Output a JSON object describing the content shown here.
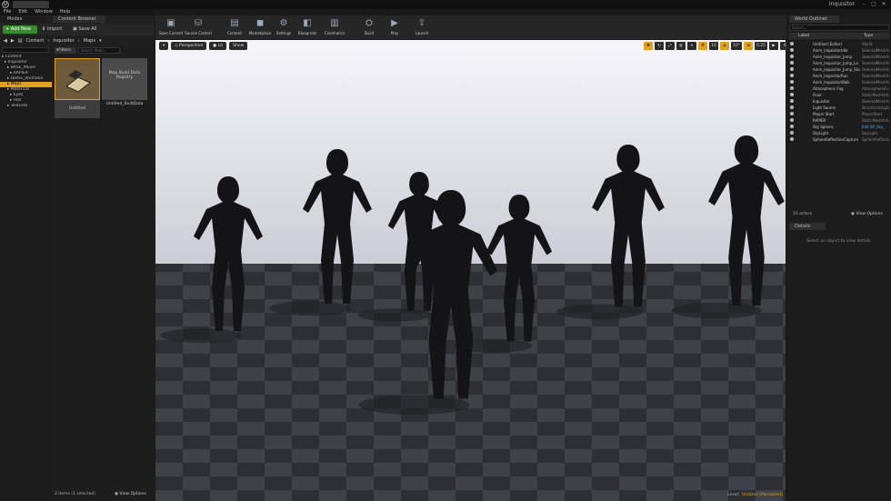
{
  "app": {
    "logo": "U",
    "project": "Inquisitor",
    "window_controls": [
      "–",
      "▢",
      "✕"
    ]
  },
  "menu": [
    "File",
    "Edit",
    "Window",
    "Help"
  ],
  "left_panel": {
    "tabs": {
      "modes": "Modes",
      "content_browser": "Content Browser"
    },
    "toolbar": {
      "add_new": "Add New",
      "import": "Import",
      "save_all": "Save All"
    },
    "breadcrumb": [
      "Content",
      "Inquisitor",
      "Maps"
    ],
    "tree": [
      {
        "label": "Content",
        "indent": 0
      },
      {
        "label": "Inquisitor",
        "indent": 1
      },
      {
        "label": "BASE_MESH",
        "indent": 2
      },
      {
        "label": "RAPIER",
        "indent": 3
      },
      {
        "label": "Demo_Animatio",
        "indent": 2
      },
      {
        "label": "Maps",
        "indent": 2,
        "selected": true
      },
      {
        "label": "Materials",
        "indent": 2
      },
      {
        "label": "Eyes",
        "indent": 3
      },
      {
        "label": "Hair",
        "indent": 3
      },
      {
        "label": "Textures",
        "indent": 2
      }
    ],
    "filters": "Filters",
    "search_placeholder": "Search Maps",
    "assets": [
      {
        "label": "Untitled",
        "thumb": "map-icon"
      },
      {
        "label": "Untitled_BuiltData",
        "thumb_text": "Map Build Data Registry"
      }
    ],
    "status": "2 items (1 selected)",
    "view_options": "View Options"
  },
  "toolbar": [
    {
      "label": "Save Current",
      "icon": "save-icon"
    },
    {
      "label": "Source Control",
      "icon": "source-control-icon"
    },
    {
      "label": "Content",
      "icon": "content-icon"
    },
    {
      "label": "Marketplace",
      "icon": "marketplace-icon"
    },
    {
      "label": "Settings",
      "icon": "settings-icon"
    },
    {
      "label": "Blueprints",
      "icon": "blueprints-icon"
    },
    {
      "label": "Cinematics",
      "icon": "cinematics-icon"
    },
    {
      "label": "Build",
      "icon": "build-icon"
    },
    {
      "label": "Play",
      "icon": "play-icon"
    },
    {
      "label": "Launch",
      "icon": "launch-icon"
    }
  ],
  "viewport": {
    "perspective": "Perspective",
    "lit": "Lit",
    "show": "Show",
    "snap": {
      "grid": "10",
      "rotation": "10°",
      "scale": "0.25",
      "camera_speed": "4"
    },
    "level_label": "Level:",
    "level_value": "Untitled (Persistent)"
  },
  "outliner": {
    "tab": "World Outliner",
    "search_placeholder": "Search...",
    "col_label": "Label",
    "col_type": "Type",
    "rows": [
      {
        "name": "Untitled (Editor)",
        "type": "World"
      },
      {
        "name": "Anim_InquisitorIdle",
        "type": "SkeletalMeshActor"
      },
      {
        "name": "Anim_Inquisitor_Jump",
        "type": "SkeletalMeshActor"
      },
      {
        "name": "Anim_Inquisitor_Jump_Lo",
        "type": "SkeletalMeshActor"
      },
      {
        "name": "Anim_Inquisitor_Jump_Sta",
        "type": "SkeletalMeshActor"
      },
      {
        "name": "Anim_InquisitorRun",
        "type": "SkeletalMeshActor"
      },
      {
        "name": "Anim_InquisitorWalk",
        "type": "SkeletalMeshActor"
      },
      {
        "name": "Atmospheric Fog",
        "type": "AtmosphericFog"
      },
      {
        "name": "Floor",
        "type": "StaticMeshActor"
      },
      {
        "name": "Inquisitor",
        "type": "SkeletalMeshActor"
      },
      {
        "name": "Light Source",
        "type": "DirectionalLight"
      },
      {
        "name": "Player Start",
        "type": "PlayerStart"
      },
      {
        "name": "RAPIER",
        "type": "StaticMeshActor"
      },
      {
        "name": "Sky Sphere",
        "type": "Edit BP_Sky_",
        "link": true
      },
      {
        "name": "SkyLight",
        "type": "SkyLight"
      },
      {
        "name": "SphereReflectionCapture",
        "type": "SphereReflectionCapture"
      }
    ],
    "count": "16 actors",
    "view_options": "View Options"
  },
  "details": {
    "tab": "Details",
    "empty": "Select an object to view details."
  }
}
